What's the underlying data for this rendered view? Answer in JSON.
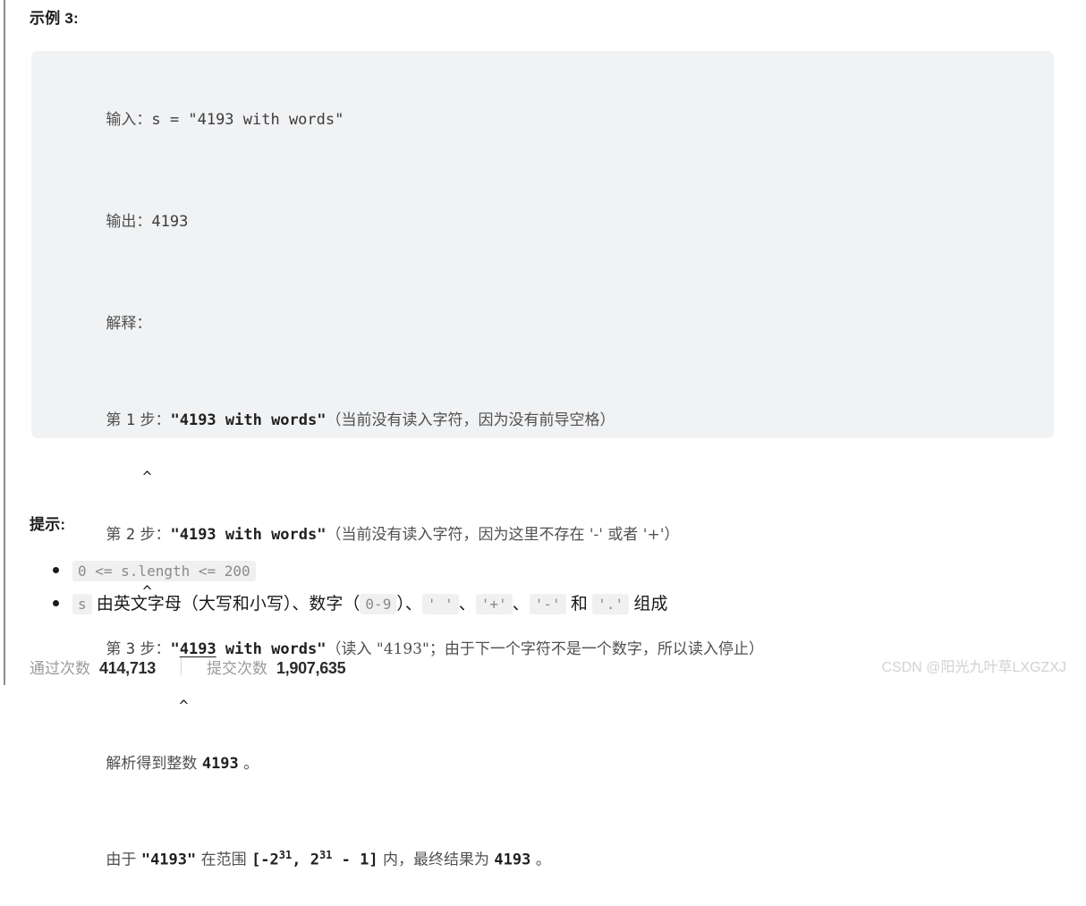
{
  "page": {
    "left_rule_color": "#8c8c8c",
    "background": "#ffffff"
  },
  "example": {
    "title": "示例 3:",
    "block_background": "#f1f2f4",
    "lines": [
      {
        "cn_prefix": "输入：",
        "code": "s = \"4193 with words\""
      },
      {
        "cn_prefix": "输出：",
        "code": "4193"
      },
      {
        "cn_prefix": "解释：",
        "code": ""
      }
    ],
    "steps": [
      {
        "label_prefix": "第 ",
        "number": "1",
        "label_suffix": " 步：",
        "code": "\"4193 with words\"",
        "note": "（当前没有读入字符，因为没有前导空格）",
        "caret": "          ^"
      },
      {
        "label_prefix": "第 ",
        "number": "2",
        "label_suffix": " 步：",
        "code": "\"4193 with words\"",
        "note": "（当前没有读入字符，因为这里不存在 '-' 或者 '+'）",
        "caret": "          ^"
      },
      {
        "label_prefix": "第 ",
        "number": "3",
        "label_suffix": " 步：",
        "code_open_quote": "\"",
        "code_underlined": "4193",
        "code_rest": " with words\"",
        "note": "（读入 \"4193\"；由于下一个字符不是一个数字，所以读入停止）",
        "caret": "              ^"
      }
    ],
    "result_lines": {
      "parse_prefix": "解析得到整数 ",
      "parse_value": "4193",
      "parse_suffix": " 。",
      "range_prefix": "由于 ",
      "range_value": "\"4193\"",
      "range_mid": " 在范围 ",
      "range_expr_a": "[-2",
      "range_exp_a": "31",
      "range_expr_b": ", 2",
      "range_exp_b": "31",
      "range_expr_c": " - 1]",
      "range_mid2": " 内，最终结果为 ",
      "range_result": "4193",
      "range_suffix": " 。"
    }
  },
  "hints": {
    "title": "提示:",
    "items": [
      {
        "code": "0 <= s.length <= 200"
      },
      {
        "code_s": "s",
        "text_a": " 由英文字母（大写和小写）、数字（",
        "code_digits": "0-9",
        "text_b": "）、",
        "code_space": "' '",
        "text_c": "、",
        "code_plus": "'+'",
        "text_d": "、",
        "code_minus": "'-'",
        "text_e": " 和 ",
        "code_dot": "'.'",
        "text_f": " 组成"
      }
    ]
  },
  "footer": {
    "accepted_label": "通过次数",
    "accepted_value": "414,713",
    "submissions_label": "提交次数",
    "submissions_value": "1,907,635",
    "watermark": "CSDN @阳光九叶草LXGZXJ"
  }
}
